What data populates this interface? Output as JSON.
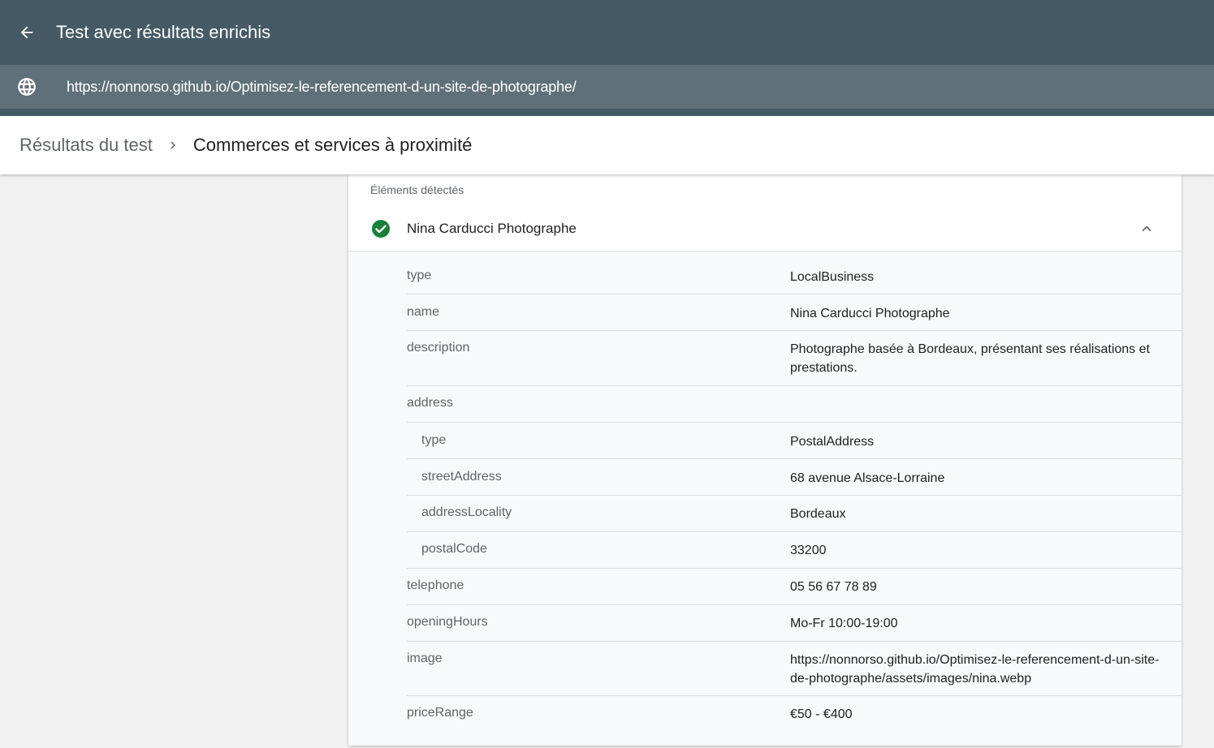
{
  "header": {
    "title": "Test avec résultats enrichis",
    "url": "https://nonnorso.github.io/Optimisez-le-referencement-d-un-site-de-photographe/"
  },
  "breadcrumb": {
    "parent": "Résultats du test",
    "current": "Commerces et services à proximité"
  },
  "card": {
    "section_label": "Éléments détectés",
    "item_name": "Nina Carducci Photographe",
    "status": "valid",
    "accent_color": "#188038",
    "properties": [
      {
        "key": "type",
        "value": "LocalBusiness"
      },
      {
        "key": "name",
        "value": "Nina Carducci Photographe"
      },
      {
        "key": "description",
        "value": "Photographe basée à Bordeaux, présentant ses réalisations et prestations."
      },
      {
        "key": "address",
        "value": ""
      },
      {
        "key": "type",
        "value": "PostalAddress"
      },
      {
        "key": "streetAddress",
        "value": "68 avenue Alsace-Lorraine"
      },
      {
        "key": "addressLocality",
        "value": "Bordeaux"
      },
      {
        "key": "postalCode",
        "value": "33200"
      },
      {
        "key": "telephone",
        "value": "05 56 67 78 89"
      },
      {
        "key": "openingHours",
        "value": "Mo-Fr 10:00-19:00"
      },
      {
        "key": "image",
        "value": "https://nonnorso.github.io/Optimisez-le-referencement-d-un-site-de-photographe/assets/images/nina.webp"
      },
      {
        "key": "priceRange",
        "value": "€50 - €400"
      }
    ]
  },
  "icons": {
    "back": "arrow-back-icon",
    "globe": "globe-icon",
    "separator": "chevron-right-icon",
    "status": "check-circle-icon",
    "collapse": "chevron-up-icon"
  }
}
